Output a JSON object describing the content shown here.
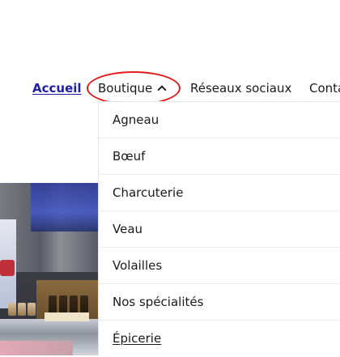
{
  "nav": {
    "items": [
      {
        "label": "Accueil"
      },
      {
        "label": "Boutique"
      },
      {
        "label": "Réseaux sociaux"
      },
      {
        "label": "Conta"
      }
    ]
  },
  "dropdown": {
    "items": [
      {
        "label": "Agneau"
      },
      {
        "label": "Bœuf"
      },
      {
        "label": "Charcuterie"
      },
      {
        "label": "Veau"
      },
      {
        "label": "Volailles"
      },
      {
        "label": "Nos spécialités"
      },
      {
        "label": "Épicerie"
      }
    ]
  },
  "colors": {
    "highlight_ring": "#e01c1c",
    "active_link": "#1f1fa6"
  },
  "icons": {
    "boutique_caret": "chevron-up-icon"
  }
}
